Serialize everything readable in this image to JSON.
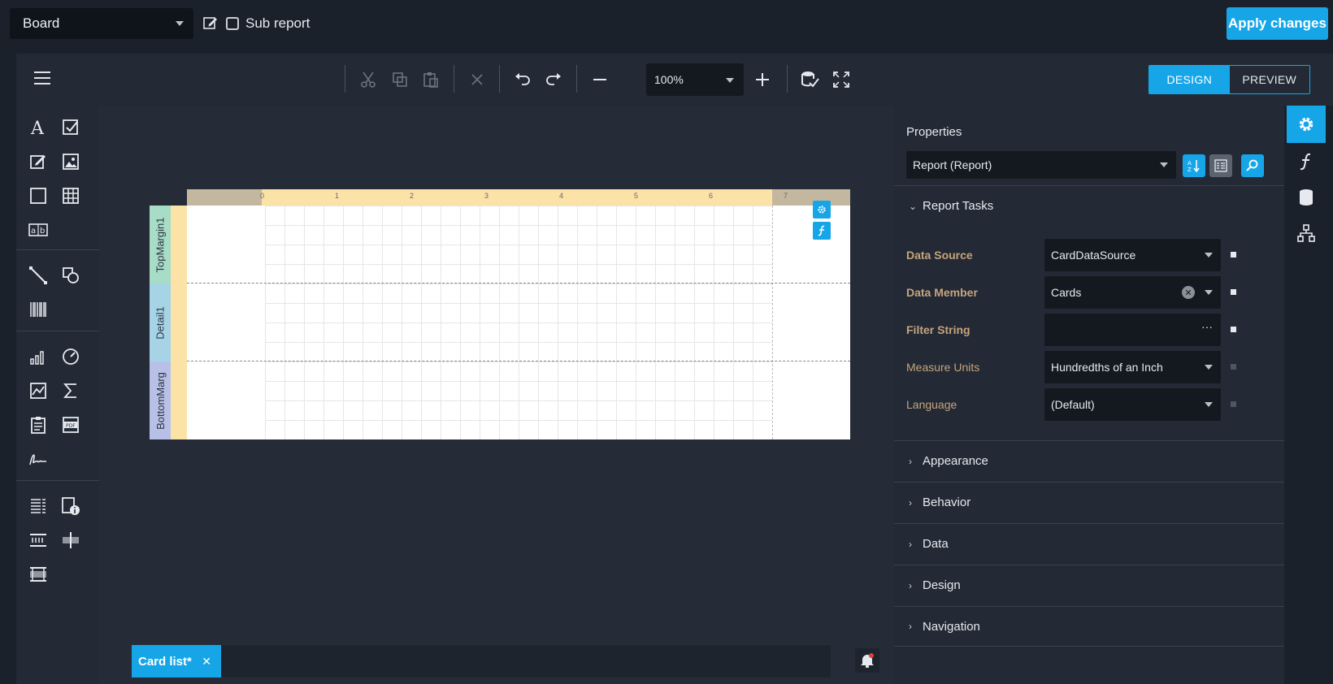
{
  "topbar": {
    "board_select": "Board",
    "sub_report_label": "Sub report",
    "apply_label": "Apply changes"
  },
  "toolbar": {
    "zoom": "100%",
    "design_label": "DESIGN",
    "preview_label": "PREVIEW"
  },
  "report": {
    "ruler_numbers": [
      "0",
      "1",
      "2",
      "3",
      "4",
      "5",
      "6",
      "7"
    ],
    "bands": [
      "TopMargin1",
      "Detail1",
      "BottomMarg"
    ]
  },
  "tabs": {
    "active_label": "Card list*",
    "close": "✕"
  },
  "properties": {
    "title": "Properties",
    "object": "Report (Report)",
    "tasks_header": "Report Tasks",
    "rows": [
      {
        "label": "Data Source",
        "value": "CardDataSource"
      },
      {
        "label": "Data Member",
        "value": "Cards"
      },
      {
        "label": "Filter String",
        "value": ""
      },
      {
        "label": "Measure Units",
        "value": "Hundredths of an Inch"
      },
      {
        "label": "Language",
        "value": "(Default)"
      }
    ],
    "filter_dots": "···",
    "clear_glyph": "✕",
    "sections": [
      "Appearance",
      "Behavior",
      "Data",
      "Design",
      "Navigation"
    ],
    "expanded_chevron": "⌄",
    "collapsed_chevron": "›"
  },
  "colors": {
    "accent": "#16a6e8",
    "panel": "#232a35",
    "background": "#1b212b",
    "label_bold": "#c5a47c"
  },
  "icons": {
    "rail": [
      "gear-icon",
      "function-icon",
      "database-icon",
      "hierarchy-icon"
    ]
  }
}
